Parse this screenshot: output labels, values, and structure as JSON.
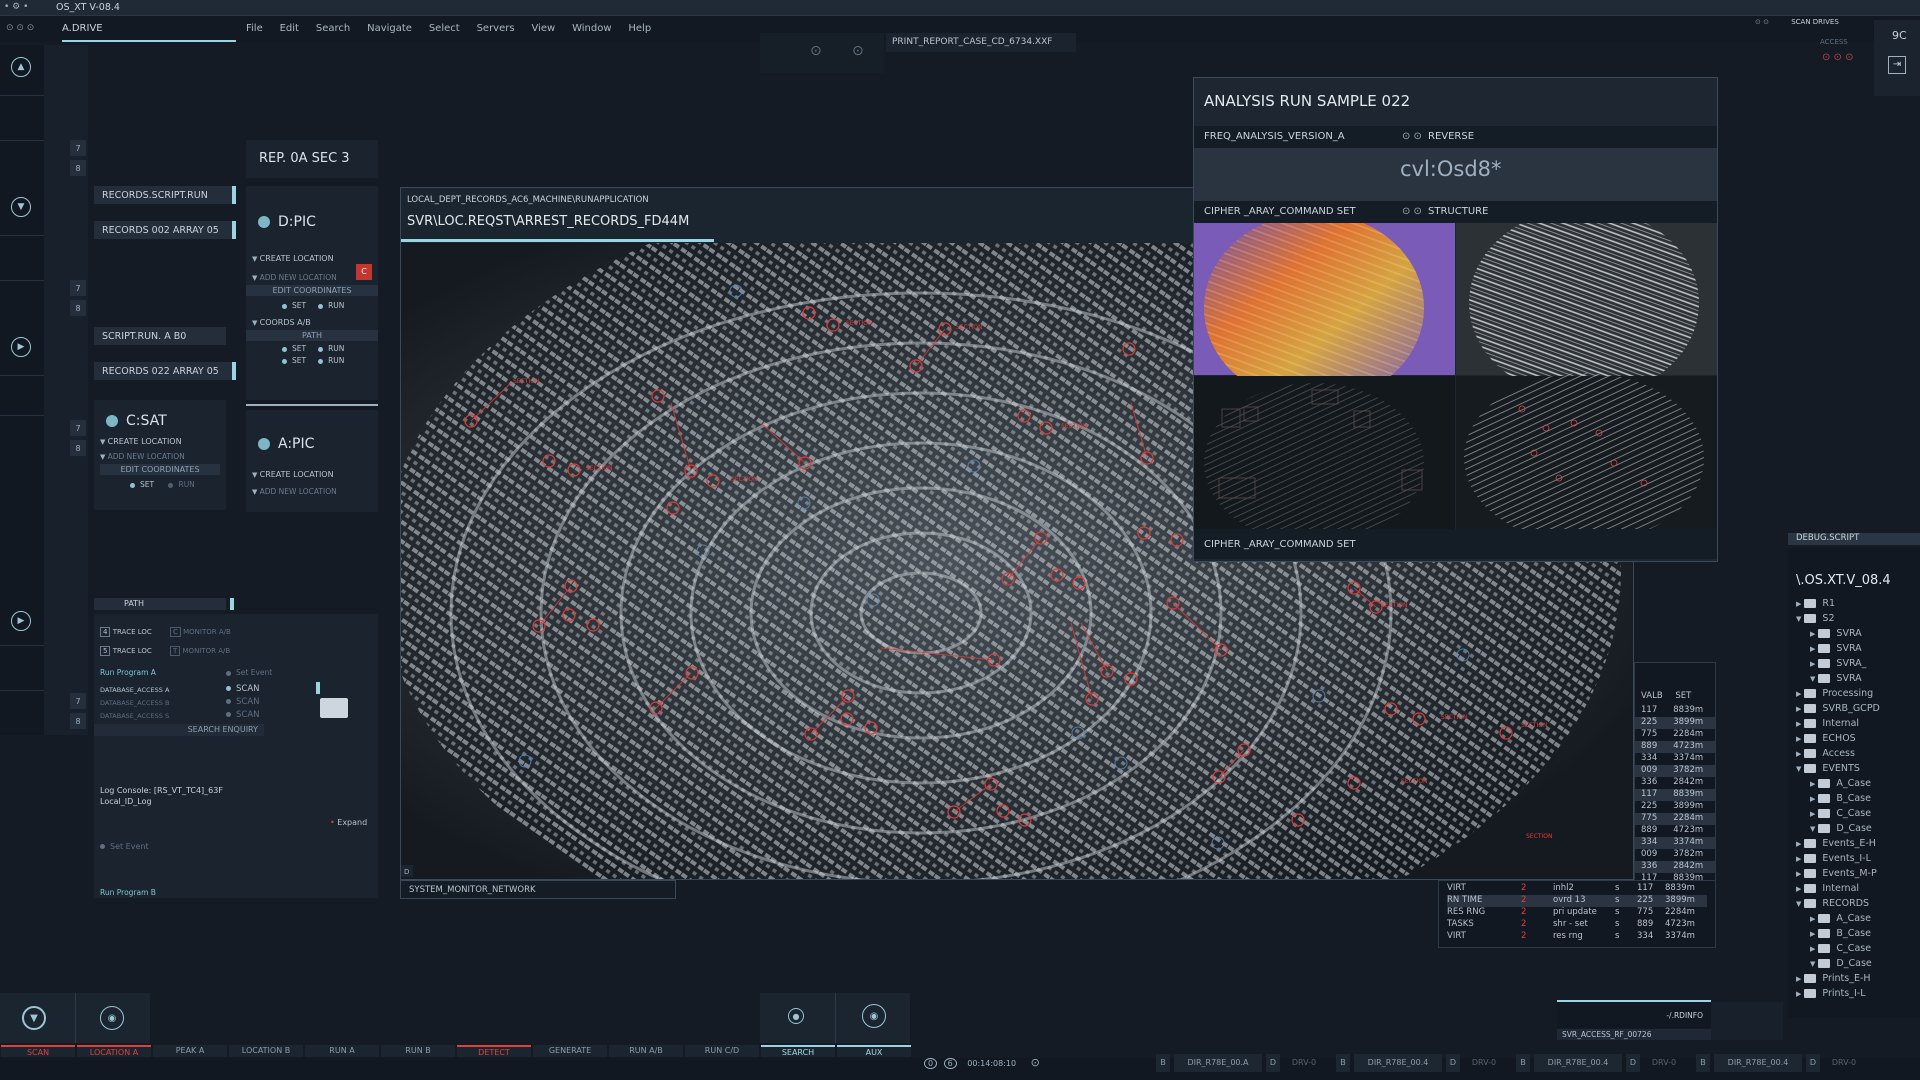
{
  "app": {
    "title": "OS_XT V-08.4",
    "drive": "A.DRIVE",
    "corner_code": "9C"
  },
  "menu": [
    "File",
    "Edit",
    "Search",
    "Navigate",
    "Select",
    "Servers",
    "View",
    "Window",
    "Help"
  ],
  "top_right": {
    "scan_drives": "SCAN DRIVES",
    "access": "ACCESS"
  },
  "print_report": "PRINT_REPORT_CASE_CD_6734.XXF",
  "left_numbers": {
    "n7": "7",
    "n8": "8"
  },
  "scripts": {
    "records_script": "RECORDS.SCRIPT.RUN",
    "records_array_1": "RECORDS 002 ARRAY 05",
    "script_run": "SCRIPT.RUN. A B0",
    "records_array_2": "RECORDS 022 ARRAY 05"
  },
  "csat": {
    "title": "C:SAT",
    "create_location": "CREATE LOCATION",
    "add_new_location": "ADD NEW LOCATION",
    "edit_coordinates": "EDIT COORDINATES",
    "set": "SET",
    "run": "RUN"
  },
  "rep_header": "REP. 0A SEC 3",
  "dpic": {
    "title": "D:PIC",
    "create_location": "CREATE LOCATION",
    "badge": "C",
    "add_new_location": "ADD NEW LOCATION",
    "edit_coordinates": "EDIT COORDINATES",
    "set": "SET",
    "run": "RUN",
    "coords": "COORDS A/B",
    "path": "PATH"
  },
  "apic": {
    "title": "A:PIC",
    "create_location": "CREATE LOCATION",
    "add_new_location": "ADD NEW LOCATION"
  },
  "path_panel": {
    "title": "PATH",
    "trace_loc": "TRACE LOC",
    "monitor": "MONITOR A/B",
    "run_program_a": "Run Program A",
    "set_event": "Set Event",
    "db_a": "DATABASE_ACCESS A",
    "db_b": "DATABASE_ACCESS B",
    "db_s": "DATABASE_ACCESS S",
    "scan": "SCAN",
    "search_enquiry": "SEARCH ENQUIRY",
    "log_console": "Log Console: [RS_VT_TC4]_63F",
    "local_log": "Local_ID_Log",
    "expand": "Expand",
    "set_event_2": "Set Event",
    "run_program_b": "Run Program B"
  },
  "main_window": {
    "path": "LOCAL_DEPT_RECORDS_AC6_MACHINE\\RUNAPPLICATION",
    "title": "SVR\\LOC.REQST\\ARREST_RECORDS_FD44M",
    "corner": "D"
  },
  "system_monitor": "SYSTEM_MONITOR_NETWORK",
  "analysis": {
    "title": "ANALYSIS RUN SAMPLE 022",
    "freq": "FREQ_ANALYSIS_VERSION_A",
    "reverse": "REVERSE",
    "value": "cvl:Osd8*",
    "cipher": "CIPHER _ARAY_COMMAND SET",
    "structure": "STRUCTURE",
    "cipher_bottom": "CIPHER _ARAY_COMMAND SET"
  },
  "valb_table": {
    "headers": [
      "VALB",
      "SET"
    ],
    "rows": [
      [
        "117",
        "8839m"
      ],
      [
        "225",
        "3899m"
      ],
      [
        "775",
        "2284m"
      ],
      [
        "889",
        "4723m"
      ],
      [
        "334",
        "3374m"
      ],
      [
        "009",
        "3782m"
      ],
      [
        "336",
        "2842m"
      ],
      [
        "117",
        "8839m"
      ],
      [
        "225",
        "3899m"
      ],
      [
        "775",
        "2284m"
      ],
      [
        "889",
        "4723m"
      ],
      [
        "334",
        "3374m"
      ],
      [
        "009",
        "3782m"
      ],
      [
        "336",
        "2842m"
      ],
      [
        "117",
        "8839m"
      ],
      [
        "225",
        "3899m"
      ],
      [
        "775",
        "2284m"
      ],
      [
        "889",
        "4723m"
      ],
      [
        "334",
        "3374m"
      ]
    ]
  },
  "stats": [
    [
      "VIRT",
      "2",
      "inhl2",
      "s"
    ],
    [
      "RN TIME",
      "2",
      "ovrd  13",
      "s"
    ],
    [
      "RES RNG",
      "2",
      "pri update",
      "s"
    ],
    [
      "TASKS",
      "2",
      "shr - set",
      "s"
    ],
    [
      "VIRT",
      "2",
      "res rng",
      "s"
    ]
  ],
  "debug": {
    "title": "DEBUG.SCRIPT",
    "root": "\\.OS.XT.V_08.4",
    "tree": [
      [
        "R1",
        0,
        "c"
      ],
      [
        "S2",
        0,
        "o"
      ],
      [
        "SVRA",
        1,
        "c"
      ],
      [
        "SVRA",
        1,
        "c"
      ],
      [
        "SVRA_",
        1,
        "c"
      ],
      [
        "SVRA",
        1,
        "o"
      ],
      [
        "Processing",
        0,
        "c"
      ],
      [
        "SVRB_GCPD",
        0,
        "c"
      ],
      [
        "Internal",
        0,
        "c"
      ],
      [
        "ECHOS",
        0,
        "c"
      ],
      [
        "Access",
        0,
        "c"
      ],
      [
        "EVENTS",
        0,
        "o"
      ],
      [
        "A_Case",
        1,
        "c"
      ],
      [
        "B_Case",
        1,
        "c"
      ],
      [
        "C_Case",
        1,
        "c"
      ],
      [
        "D_Case",
        1,
        "o"
      ],
      [
        "Events_E-H",
        0,
        "c"
      ],
      [
        "Events_I-L",
        0,
        "c"
      ],
      [
        "Events_M-P",
        0,
        "c"
      ],
      [
        "Internal",
        0,
        "c"
      ],
      [
        "RECORDS",
        0,
        "o"
      ],
      [
        "A_Case",
        1,
        "c"
      ],
      [
        "B_Case",
        1,
        "c"
      ],
      [
        "C_Case",
        1,
        "c"
      ],
      [
        "D_Case",
        1,
        "o"
      ],
      [
        "Prints_E-H",
        0,
        "c"
      ],
      [
        "Prints_I-L",
        0,
        "c"
      ]
    ]
  },
  "rdinfo": "-/.RDINFO",
  "svr_access": "SVR_ACCESS_RF_00726",
  "bottom_tabs": [
    "SCAN",
    "LOCATION A",
    "PEAK A",
    "LOCATION B",
    "RUN A",
    "RUN B",
    "DETECT",
    "GENERATE",
    "RUN A/B",
    "RUN C/D",
    "SEARCH",
    "AUX"
  ],
  "timer": "00:14:08:10",
  "footer": {
    "b": "B",
    "d": "D",
    "dir": "DIR_R78E_00.4",
    "dir_a": "DIR_R78E_00.A",
    "drv": "DRV-0"
  },
  "colors": {
    "accent": "#9bd4e2",
    "alert": "#e0403a",
    "bg": "#141b25"
  }
}
